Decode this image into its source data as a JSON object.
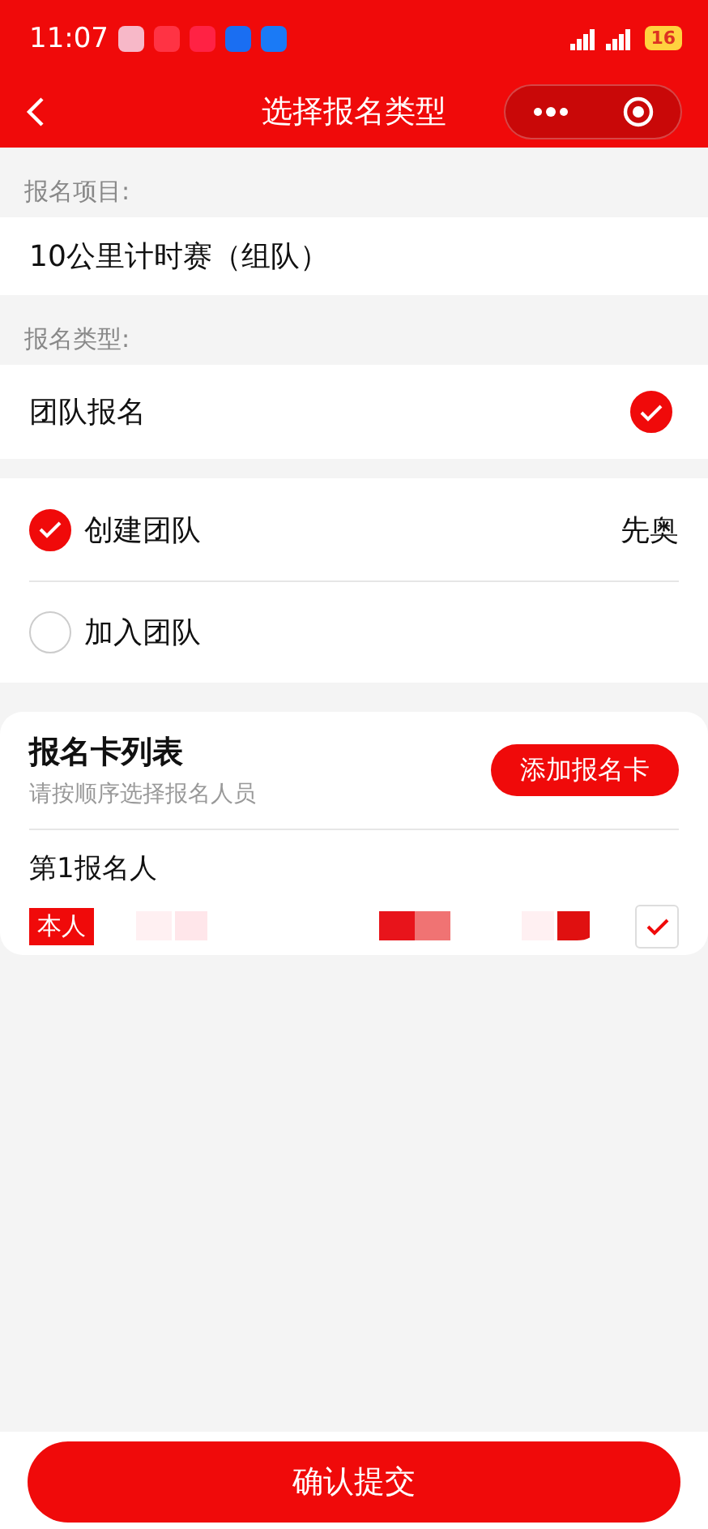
{
  "status_bar": {
    "time": "11:07",
    "battery": "16"
  },
  "nav": {
    "title": "选择报名类型"
  },
  "project": {
    "label": "报名项目:",
    "value": "10公里计时赛（组队）"
  },
  "signup_type": {
    "label": "报名类型:",
    "options": [
      {
        "label": "团队报名",
        "selected": true
      }
    ]
  },
  "team_options": [
    {
      "label": "创建团队",
      "selected": true,
      "value": "先奥"
    },
    {
      "label": "加入团队",
      "selected": false
    }
  ],
  "card_list": {
    "title": "报名卡列表",
    "subtitle": "请按顺序选择报名人员",
    "add_button": "添加报名卡",
    "entries": [
      {
        "label": "第1报名人",
        "tag": "本人",
        "checked": true
      }
    ]
  },
  "submit": "确认提交"
}
